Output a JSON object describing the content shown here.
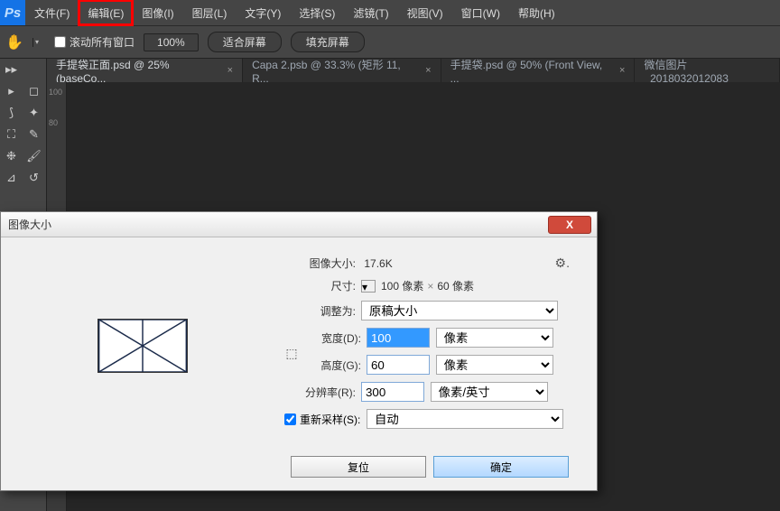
{
  "menubar": {
    "items": [
      {
        "label": "文件(F)"
      },
      {
        "label": "编辑(E)"
      },
      {
        "label": "图像(I)"
      },
      {
        "label": "图层(L)"
      },
      {
        "label": "文字(Y)"
      },
      {
        "label": "选择(S)"
      },
      {
        "label": "滤镜(T)"
      },
      {
        "label": "视图(V)"
      },
      {
        "label": "窗口(W)"
      },
      {
        "label": "帮助(H)"
      }
    ]
  },
  "optbar": {
    "scroll_all": "滚动所有窗口",
    "zoom": "100%",
    "fit_screen": "适合屏幕",
    "fill_screen": "填充屏幕"
  },
  "tabs": [
    {
      "label": "手提袋正面.psd @ 25% (baseCo...",
      "active": true
    },
    {
      "label": "Capa 2.psb @ 33.3% (矩形 11, R...",
      "active": false
    },
    {
      "label": "手提袋.psd @ 50% (Front View, ...",
      "active": false
    },
    {
      "label": "微信图片_2018032012083",
      "active": false
    }
  ],
  "ruler_v": [
    "100",
    "80"
  ],
  "dialog": {
    "title": "图像大小",
    "size_label": "图像大小:",
    "size_val": "17.6K",
    "dim_label": "尺寸:",
    "dim_w": "100 像素",
    "dim_h": "60 像素",
    "adjust_label": "调整为:",
    "adjust_val": "原稿大小",
    "width_label": "宽度(D):",
    "width_val": "100",
    "width_unit": "像素",
    "height_label": "高度(G):",
    "height_val": "60",
    "height_unit": "像素",
    "res_label": "分辨率(R):",
    "res_val": "300",
    "res_unit": "像素/英寸",
    "resample_label": "重新采样(S):",
    "resample_val": "自动",
    "reset": "复位",
    "ok": "确定"
  },
  "logo": "Ps"
}
